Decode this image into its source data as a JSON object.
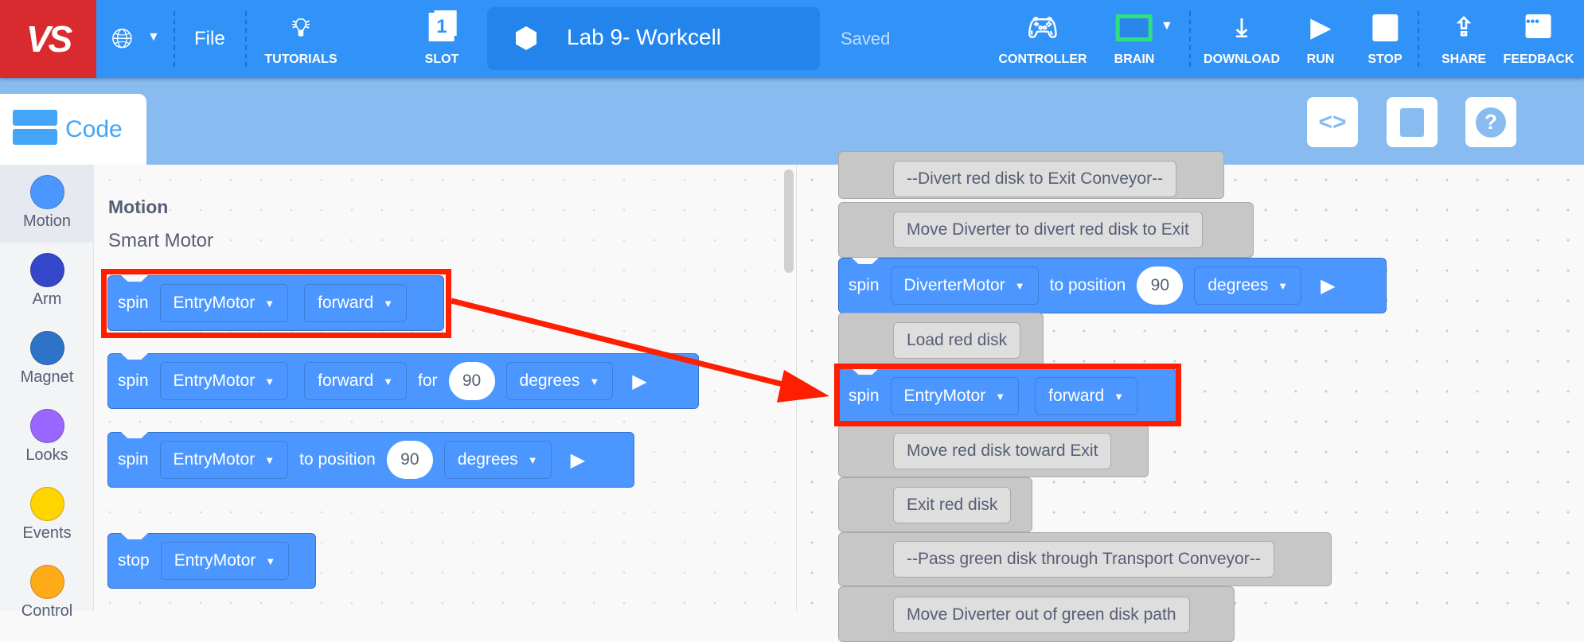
{
  "topbar": {
    "logo": "VS",
    "file": "File",
    "tutorials": "TUTORIALS",
    "slot": "SLOT",
    "slot_number": "1",
    "project_title": "Lab 9- Workcell",
    "save_status": "Saved",
    "controller": "CONTROLLER",
    "brain": "BRAIN",
    "download": "DOWNLOAD",
    "run": "RUN",
    "stop": "STOP",
    "share": "SHARE",
    "feedback": "FEEDBACK",
    "brain_color": "#2ee07f"
  },
  "code_tab": {
    "label": "Code"
  },
  "right_tools": [
    "code-view-icon",
    "device-port-icon",
    "help-icon"
  ],
  "categories": [
    {
      "label": "Motion",
      "color": "#4c97ff"
    },
    {
      "label": "Arm",
      "color": "#3447c9"
    },
    {
      "label": "Magnet",
      "color": "#2f73c9"
    },
    {
      "label": "Looks",
      "color": "#9966ff"
    },
    {
      "label": "Events",
      "color": "#ffd500"
    },
    {
      "label": "Control",
      "color": "#ffab19"
    }
  ],
  "palette": {
    "title": "Motion",
    "subtitle": "Smart Motor",
    "b1": {
      "verb": "spin",
      "motor": "EntryMotor",
      "dir": "forward"
    },
    "b2": {
      "verb": "spin",
      "motor": "EntryMotor",
      "dir": "forward",
      "for": "for",
      "value": "90",
      "unit": "degrees"
    },
    "b3": {
      "verb": "spin",
      "motor": "EntryMotor",
      "to": "to position",
      "value": "90",
      "unit": "degrees"
    },
    "b4": {
      "verb": "stop",
      "motor": "EntryMotor"
    }
  },
  "workspace": {
    "c1": "--Divert red disk to Exit Conveyor--",
    "c2": "Move Diverter to divert red disk to Exit",
    "s1": {
      "verb": "spin",
      "motor": "DiverterMotor",
      "to": "to position",
      "value": "90",
      "unit": "degrees"
    },
    "c3": "Load red disk",
    "s2": {
      "verb": "spin",
      "motor": "EntryMotor",
      "dir": "forward"
    },
    "c4": "Move red disk toward Exit",
    "c5": "Exit red disk",
    "c6": "--Pass green disk through Transport Conveyor--",
    "c7": "Move Diverter out of green disk path"
  },
  "annotation_color": "#fe1e00"
}
